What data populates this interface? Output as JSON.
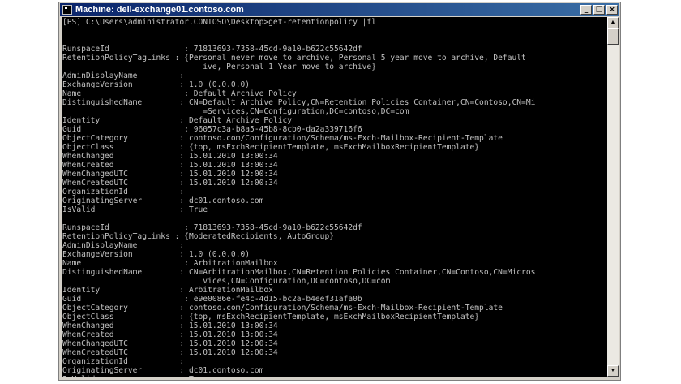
{
  "window": {
    "title": "Machine: dell-exchange01.contoso.com"
  },
  "controls": {
    "minimize": "_",
    "maximize": "□",
    "close": "×"
  },
  "scrollbar": {
    "up": "▲",
    "down": "▼"
  },
  "console": {
    "lines": [
      "[PS] C:\\Users\\administrator.CONTOSO\\Desktop>get-retentionpolicy |fl",
      "",
      "",
      "RunspaceId                : 71813693-7358-45cd-9a10-b622c55642df",
      "RetentionPolicyTagLinks : {Personal never move to archive, Personal 5 year move to archive, Default",
      "                              ive, Personal 1 Year move to archive}",
      "AdminDisplayName         :",
      "ExchangeVersion          : 1.0 (0.0.0.0)",
      "Name                      : Default Archive Policy",
      "DistinguishedName        : CN=Default Archive Policy,CN=Retention Policies Container,CN=Contoso,CN=Mi",
      "                              =Services,CN=Configuration,DC=contoso,DC=com",
      "Identity                 : Default Archive Policy",
      "Guid                      : 96057c3a-b8a5-45b8-8cb0-da2a339716f6",
      "ObjectCategory           : contoso.com/Configuration/Schema/ms-Exch-Mailbox-Recipient-Template",
      "ObjectClass              : {top, msExchRecipientTemplate, msExchMailboxRecipientTemplate}",
      "WhenChanged              : 15.01.2010 13:00:34",
      "WhenCreated              : 15.01.2010 13:00:34",
      "WhenChangedUTC           : 15.01.2010 12:00:34",
      "WhenCreatedUTC           : 15.01.2010 12:00:34",
      "OrganizationId           :",
      "OriginatingServer        : dc01.contoso.com",
      "IsValid                  : True",
      "",
      "RunspaceId                : 71813693-7358-45cd-9a10-b622c55642df",
      "RetentionPolicyTagLinks : {ModeratedRecipients, AutoGroup}",
      "AdminDisplayName         :",
      "ExchangeVersion          : 1.0 (0.0.0.0)",
      "Name                      : ArbitrationMailbox",
      "DistinguishedName        : CN=ArbitrationMailbox,CN=Retention Policies Container,CN=Contoso,CN=Micros",
      "                              vices,CN=Configuration,DC=contoso,DC=com",
      "Identity                 : ArbitrationMailbox",
      "Guid                      : e9e0086e-fe4c-4d15-bc2a-b4eef31afa0b",
      "ObjectCategory           : contoso.com/Configuration/Schema/ms-Exch-Mailbox-Recipient-Template",
      "ObjectClass              : {top, msExchRecipientTemplate, msExchMailboxRecipientTemplate}",
      "WhenChanged              : 15.01.2010 13:00:34",
      "WhenCreated              : 15.01.2010 13:00:34",
      "WhenChangedUTC           : 15.01.2010 12:00:34",
      "WhenCreatedUTC           : 15.01.2010 12:00:34",
      "OrganizationId           :",
      "OriginatingServer        : dc01.contoso.com",
      "IsValid                  : True"
    ]
  }
}
